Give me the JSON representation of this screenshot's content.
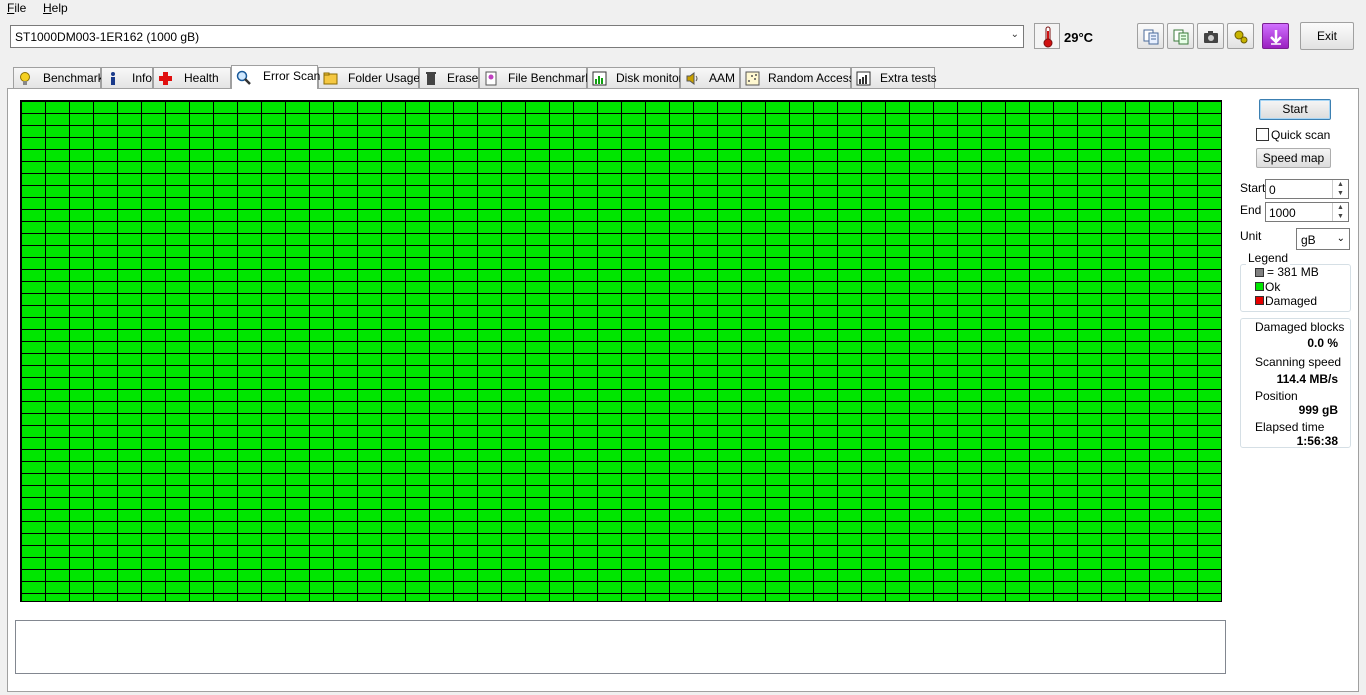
{
  "menu": {
    "file": "File",
    "help": "Help"
  },
  "drive": {
    "selected": "ST1000DM003-1ER162 (1000 gB)"
  },
  "temperature": "29°C",
  "toolbar": {
    "icons": [
      "copy-text-icon",
      "copy-info-icon",
      "camera-icon",
      "options-icon",
      "download-icon"
    ],
    "exit_label": "Exit"
  },
  "tabs": [
    {
      "label": "Benchmark",
      "icon": "bulb-icon"
    },
    {
      "label": "Info",
      "icon": "info-icon"
    },
    {
      "label": "Health",
      "icon": "health-cross-icon"
    },
    {
      "label": "Error Scan",
      "icon": "magnifier-icon",
      "active": true
    },
    {
      "label": "Folder Usage",
      "icon": "folder-icon"
    },
    {
      "label": "Erase",
      "icon": "trash-icon"
    },
    {
      "label": "File Benchmark",
      "icon": "file-benchmark-icon"
    },
    {
      "label": "Disk monitor",
      "icon": "disk-monitor-icon"
    },
    {
      "label": "AAM",
      "icon": "speaker-icon"
    },
    {
      "label": "Random Access",
      "icon": "random-access-icon"
    },
    {
      "label": "Extra tests",
      "icon": "extra-tests-icon"
    }
  ],
  "scan": {
    "start_button": "Start",
    "quick_scan_label": "Quick scan",
    "quick_scan_checked": false,
    "speed_map_button": "Speed map",
    "start_label": "Start",
    "start_value": "0",
    "end_label": "End",
    "end_value": "1000",
    "unit_label": "Unit",
    "unit_value": "gB"
  },
  "legend": {
    "title": "Legend",
    "block_size": "= 381 MB",
    "ok": "Ok",
    "damaged": "Damaged",
    "colors": {
      "block": "#808080",
      "ok": "#00e600",
      "damaged": "#e60000"
    }
  },
  "stats": {
    "damaged_blocks_label": "Damaged blocks",
    "damaged_blocks_value": "0.0 %",
    "scanning_speed_label": "Scanning speed",
    "scanning_speed_value": "114.4 MB/s",
    "position_label": "Position",
    "position_value": "999 gB",
    "elapsed_label": "Elapsed time",
    "elapsed_value": "1:56:38"
  },
  "grid": {
    "block_color": "#00e600",
    "status": "all blocks ok"
  }
}
